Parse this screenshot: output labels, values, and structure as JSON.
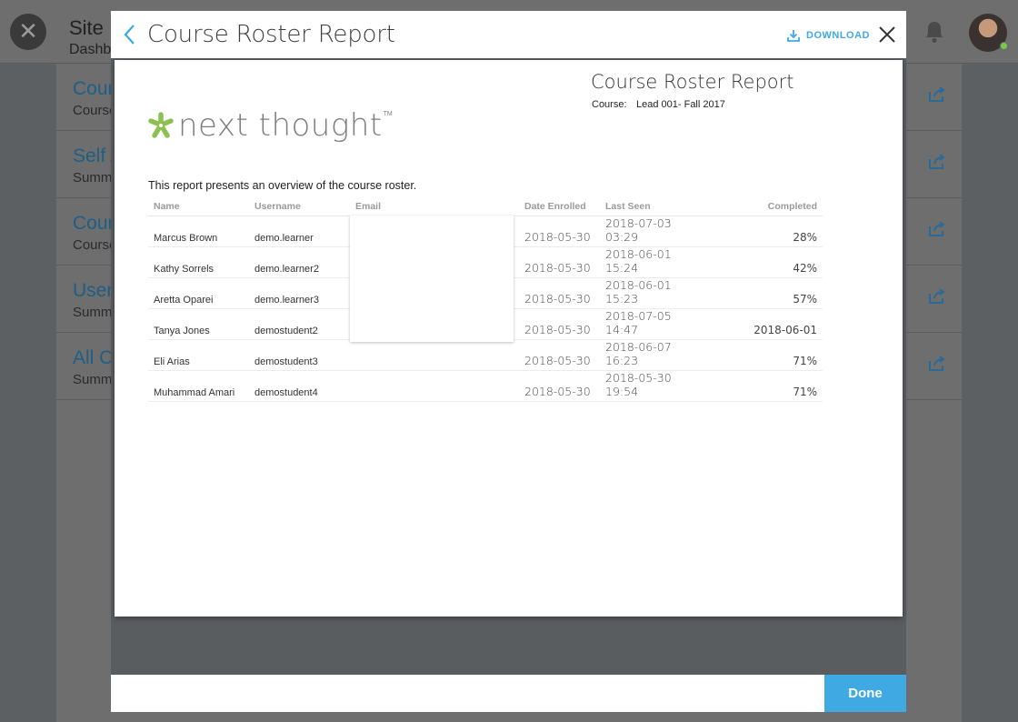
{
  "background": {
    "title": "Site",
    "subtitle": "Dashb",
    "rows": [
      {
        "title": "Cour",
        "subtitle": "Course"
      },
      {
        "title": "Self A",
        "subtitle": "Summ"
      },
      {
        "title": "Cour",
        "subtitle": "Course"
      },
      {
        "title": "User",
        "subtitle": "Summ"
      },
      {
        "title": "All C",
        "subtitle": "Summ"
      }
    ]
  },
  "modal": {
    "title": "Course Roster Report",
    "download_label": "DOWNLOAD",
    "done_label": "Done"
  },
  "report": {
    "logo_text": "next thought",
    "logo_tm": "TM",
    "title": "Course Roster Report",
    "course_label": "Course:",
    "course_value": "Lead 001- Fall 2017",
    "description": "This report presents an overview of the course roster.",
    "columns": {
      "name": "Name",
      "username": "Username",
      "email": "Email",
      "date_enrolled": "Date Enrolled",
      "last_seen": "Last Seen",
      "completed": "Completed"
    },
    "rows": [
      {
        "name": "Marcus Brown",
        "username": "demo.learner",
        "email": "",
        "date_enrolled": "2018-05-30",
        "last_seen": "2018-07-03 03:29",
        "completed": "28%"
      },
      {
        "name": "Kathy Sorrels",
        "username": "demo.learner2",
        "email": "",
        "date_enrolled": "2018-05-30",
        "last_seen": "2018-06-01 15:24",
        "completed": "42%"
      },
      {
        "name": "Aretta Oparei",
        "username": "demo.learner3",
        "email": "",
        "date_enrolled": "2018-05-30",
        "last_seen": "2018-06-01 15:23",
        "completed": "57%"
      },
      {
        "name": "Tanya Jones",
        "username": "demostudent2",
        "email": "",
        "date_enrolled": "2018-05-30",
        "last_seen": "2018-07-05 14:47",
        "completed": "2018-06-01"
      },
      {
        "name": "Eli Arias",
        "username": "demostudent3",
        "email": "",
        "date_enrolled": "2018-05-30",
        "last_seen": "2018-06-07 16:23",
        "completed": "71%"
      },
      {
        "name": "Muhammad Amari",
        "username": "demostudent4",
        "email": "",
        "date_enrolled": "2018-05-30",
        "last_seen": "2018-05-30 19:54",
        "completed": "71%"
      }
    ]
  },
  "colors": {
    "accent": "#3fa9e4",
    "logo_green": "#8cc152",
    "background_link": "#1f5e86"
  },
  "icons": {
    "back": "chevron-left-icon",
    "download": "download-icon",
    "close": "close-icon",
    "bell": "bell-icon",
    "external": "external-share-icon"
  }
}
